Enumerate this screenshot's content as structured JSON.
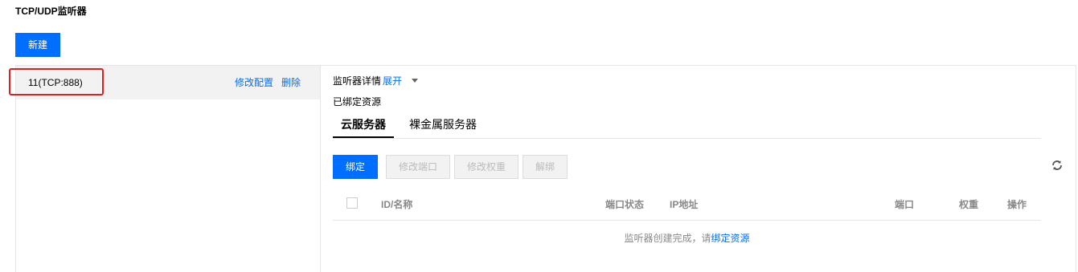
{
  "section": {
    "title": "TCP/UDP监听器"
  },
  "toolbar": {
    "new_label": "新建"
  },
  "listener": {
    "name": "11(TCP:888)",
    "edit_label": "修改配置",
    "delete_label": "删除"
  },
  "detail": {
    "label": "监听器详情",
    "expand_label": "展开",
    "bound_resources_label": "已绑定资源"
  },
  "tabs": [
    {
      "label": "云服务器",
      "active": true
    },
    {
      "label": "裸金属服务器",
      "active": false
    }
  ],
  "actions": {
    "bind": "绑定",
    "modify_port": "修改端口",
    "modify_weight": "修改权重",
    "unbind": "解绑"
  },
  "table": {
    "columns": [
      "ID/名称",
      "端口状态",
      "IP地址",
      "端口",
      "权重",
      "操作"
    ]
  },
  "empty": {
    "message": "监听器创建完成，请",
    "link": "绑定资源"
  },
  "colors": {
    "primary": "#006eff",
    "highlight": "#e02020"
  },
  "icons": {
    "refresh": "refresh-icon",
    "caret": "caret-down-icon"
  }
}
